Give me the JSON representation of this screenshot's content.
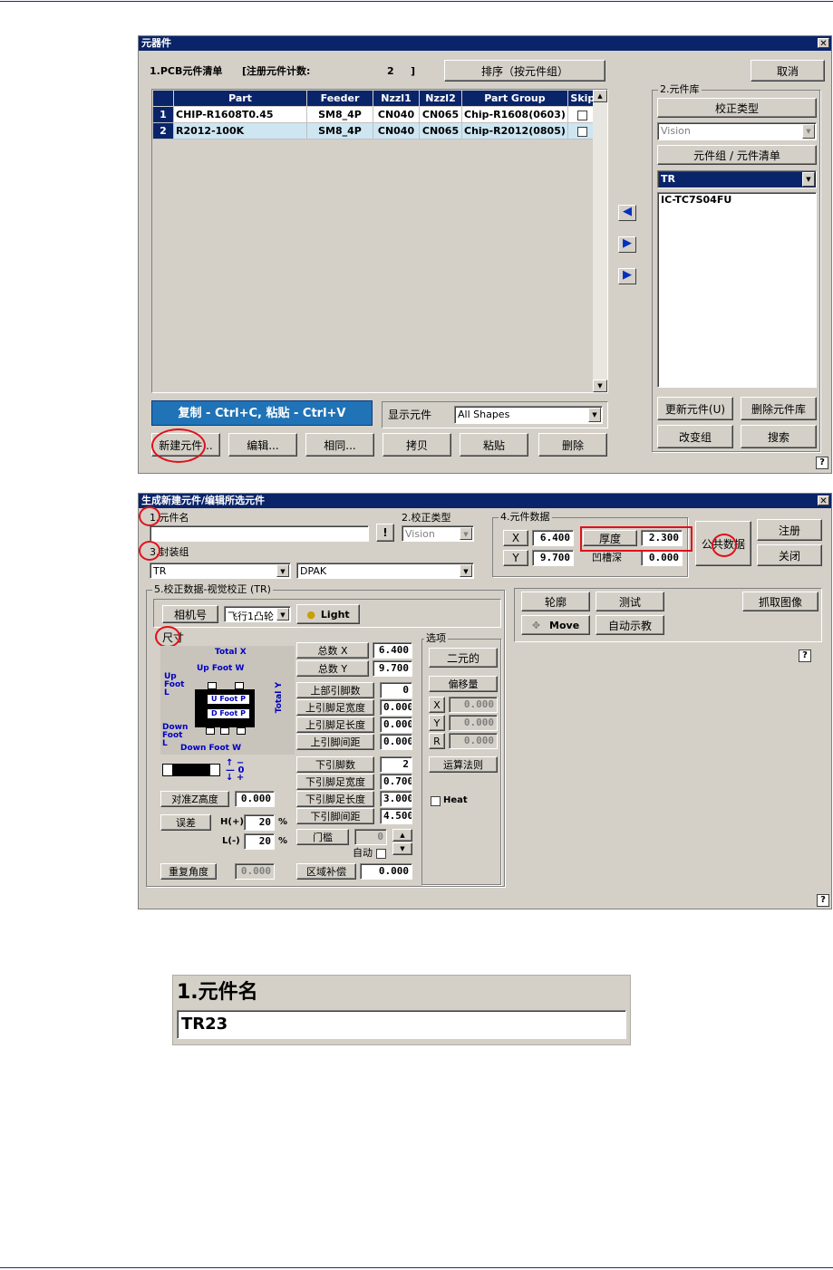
{
  "win1": {
    "title": "元器件",
    "list_label": "1.PCB元件清单",
    "count_label": "[注册元件计数:",
    "count_value": "2",
    "count_close": "]",
    "sort_button": "排序（按元件组）",
    "cancel_button": "取消",
    "table": {
      "headers": [
        "Part",
        "Feeder",
        "Nzzl1",
        "Nzzl2",
        "Part Group",
        "Skip"
      ],
      "rows": [
        {
          "n": "1",
          "part": "CHIP-R1608T0.45",
          "feeder": "SM8_4P",
          "nzzl1": "CN040",
          "nzzl2": "CN065",
          "group": "Chip-R1608(0603)"
        },
        {
          "n": "2",
          "part": "R2012-100K",
          "feeder": "SM8_4P",
          "nzzl1": "CN040",
          "nzzl2": "CN065",
          "group": "Chip-R2012(0805)"
        }
      ]
    },
    "copy_paste_banner": "复制 - Ctrl+C, 粘贴 - Ctrl+V",
    "show_parts_label": "显示元件",
    "show_parts_value": "All Shapes",
    "buttons": [
      "新建元件...",
      "编辑...",
      "相同...",
      "拷贝",
      "粘贴",
      "删除"
    ],
    "library": {
      "title": "2.元件库",
      "calib_type_label": "校正类型",
      "calib_type_value": "Vision",
      "group_list_label": "元件组 / 元件清单",
      "group_value": "TR",
      "list_items": [
        "IC-TC7S04FU"
      ],
      "update_button": "更新元件(U)",
      "delete_button": "删除元件库",
      "change_group_button": "改变组",
      "search_button": "搜索"
    },
    "help": "?"
  },
  "win2": {
    "title": "生成新建元件/编辑所选元件",
    "part_name_label": "1.元件名",
    "part_name_value": "",
    "bang_button": "!",
    "calib_type_label": "2.校正类型",
    "calib_type_value": "Vision",
    "package_label": "3.封装组",
    "package_value1": "TR",
    "package_value2": "DPAK",
    "data_group": "4.元件数据",
    "x_label": "X",
    "x_value": "6.400",
    "y_label": "Y",
    "y_value": "9.700",
    "thickness_label": "厚度",
    "thickness_value": "2.300",
    "groove_label": "凹槽深",
    "groove_value": "0.000",
    "public_data_button": "公共数据",
    "register_button": "注册",
    "close_button": "关闭",
    "calib_group": "5.校正数据-视觉校正 (TR)",
    "camera_label": "相机号",
    "camera_value": "飞行1凸轮",
    "light_button": "Light",
    "size_label": "尺寸",
    "diagram": {
      "total_x": "Total X",
      "up_foot_w": "Up Foot W",
      "up_foot_l": "Up Foot L",
      "u_foot_p": "U Foot P",
      "d_foot_p": "D Foot P",
      "total_y": "Total Y",
      "down_foot_l": "Down Foot L",
      "down_foot_w": "Down Foot W"
    },
    "fields": [
      {
        "label": "总数 X",
        "value": "6.400"
      },
      {
        "label": "总数 Y",
        "value": "9.700"
      },
      {
        "label": "上部引脚数",
        "value": "0"
      },
      {
        "label": "上引脚足宽度",
        "value": "0.000"
      },
      {
        "label": "上引脚足长度",
        "value": "0.000"
      },
      {
        "label": "上引脚间距",
        "value": "0.000"
      },
      {
        "label": "下引脚数",
        "value": "2"
      },
      {
        "label": "下引脚足宽度",
        "value": "0.700"
      },
      {
        "label": "下引脚足长度",
        "value": "3.000"
      },
      {
        "label": "下引脚间距",
        "value": "4.500"
      }
    ],
    "align_z_label": "对准Z高度",
    "align_z_value": "0.000",
    "tolerance_label": "误差",
    "h_label": "H(+)",
    "h_value": "20",
    "l_label": "L(-)",
    "l_value": "20",
    "pct": "%",
    "threshold_label": "门槛",
    "threshold_value": "0",
    "auto_label": "自动",
    "repeat_angle_label": "重复角度",
    "repeat_angle_value": "0.000",
    "area_comp_label": "区域补偿",
    "area_comp_value": "0.000",
    "options_title": "选项",
    "binary_button": "二元的",
    "offset_button": "偏移量",
    "offset_x_label": "X",
    "offset_x_value": "0.000",
    "offset_y_label": "Y",
    "offset_y_value": "0.000",
    "offset_r_label": "R",
    "offset_r_value": "0.000",
    "algorithm_button": "运算法则",
    "heat_label": "Heat",
    "outline_button": "轮廓",
    "test_button": "测试",
    "capture_button": "抓取图像",
    "move_button": "Move",
    "auto_teach_button": "自动示教",
    "help": "?"
  },
  "zoom": {
    "label": "1.元件名",
    "value": "TR23"
  }
}
